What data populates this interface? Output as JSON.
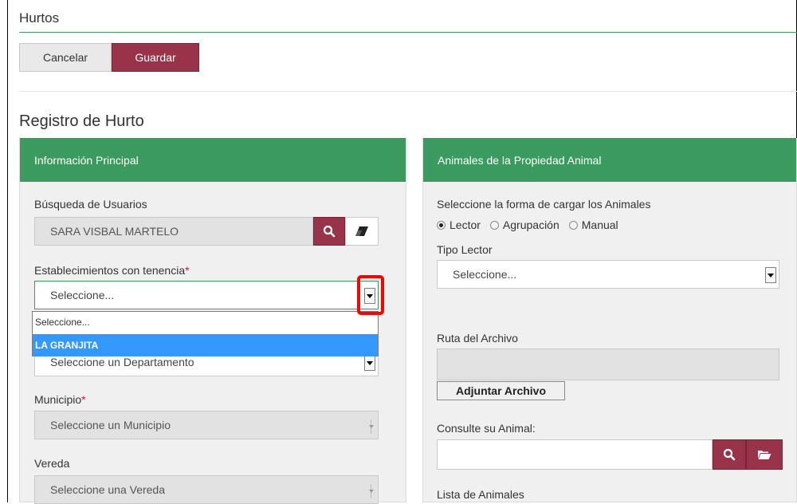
{
  "header": {
    "title": "Hurtos"
  },
  "toolbar": {
    "cancel_label": "Cancelar",
    "save_label": "Guardar"
  },
  "section": {
    "title": "Registro de Hurto"
  },
  "left_panel": {
    "heading": "Información Principal",
    "user_search": {
      "label": "Búsqueda de Usuarios",
      "value": "SARA VISBAL MARTELO"
    },
    "establishment": {
      "label": "Establecimientos con tenencia",
      "required_mark": "*",
      "value": "Seleccione...",
      "options": [
        "Seleccione...",
        "LA GRANJITA"
      ],
      "highlighted_option": "LA GRANJITA"
    },
    "department": {
      "value": "Seleccione un Departamento"
    },
    "municipality": {
      "label": "Municipio",
      "required_mark": "*",
      "value": "Seleccione un Municipio"
    },
    "village": {
      "label": "Vereda",
      "value": "Seleccione una Vereda"
    }
  },
  "right_panel": {
    "heading": "Animales de la Propiedad Animal",
    "load_mode": {
      "label": "Seleccione la forma de cargar los Animales",
      "options": [
        "Lector",
        "Agrupación",
        "Manual"
      ],
      "selected": "Lector"
    },
    "reader_type": {
      "label": "Tipo Lector",
      "value": "Seleccione..."
    },
    "file_path": {
      "label": "Ruta del Archivo",
      "value": ""
    },
    "attach_label": "Adjuntar Archivo",
    "animal_query": {
      "label": "Consulte su Animal:",
      "value": ""
    },
    "animal_list": {
      "label": "Lista de Animales"
    }
  },
  "colors": {
    "accent_green": "#3b9a5d",
    "maroon": "#99334a",
    "highlight_red": "#ff0000",
    "dropdown_selection": "#3399ff"
  },
  "icons": [
    "search-icon",
    "eraser-icon",
    "dropdown-arrow-icon",
    "folder-open-icon"
  ]
}
